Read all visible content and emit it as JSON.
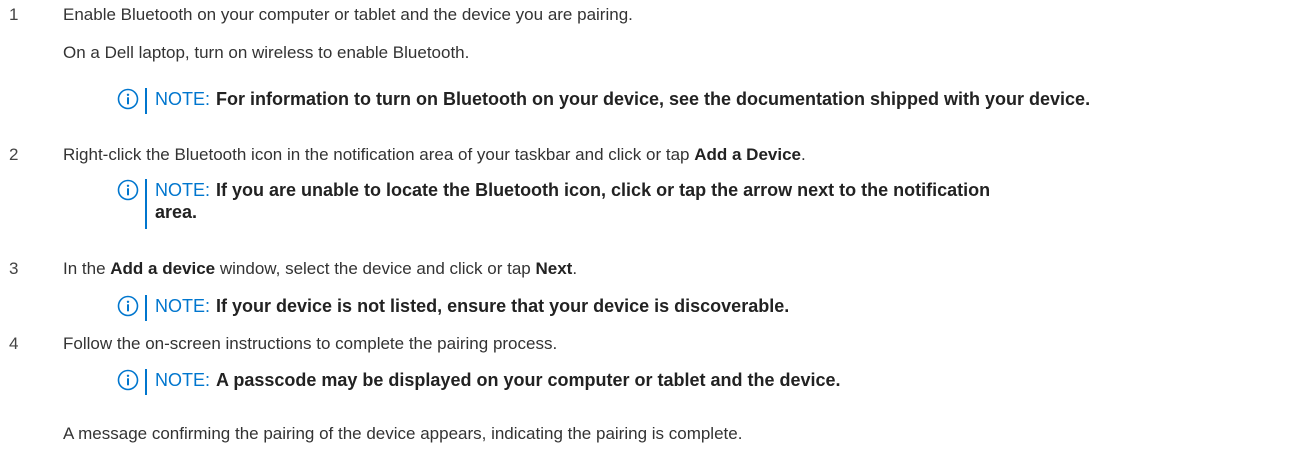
{
  "steps": [
    {
      "number": "1",
      "text": "Enable Bluetooth on your computer or tablet and the device you are pairing.",
      "subtext": "On a Dell laptop, turn on wireless to enable Bluetooth.",
      "note": "For information to turn on Bluetooth on your device, see the documentation shipped with your device."
    },
    {
      "number": "2",
      "text_before": "Right-click the Bluetooth icon in the notification area of your taskbar and click or tap ",
      "text_bold": "Add a Device",
      "text_after": ".",
      "note_line1": "If you are unable to locate the Bluetooth icon, click or tap the arrow next to the notification",
      "note_line2": "area."
    },
    {
      "number": "3",
      "text_part1": "In the ",
      "text_bold1": "Add a device",
      "text_part2": " window, select the device and click or tap ",
      "text_bold2": "Next",
      "text_part3": ".",
      "note": "If your device is not listed, ensure that your device is discoverable."
    },
    {
      "number": "4",
      "text": "Follow the on-screen instructions to complete the pairing process.",
      "note": "A passcode may be displayed on your computer or tablet and the device."
    }
  ],
  "note_label": "NOTE:",
  "closing": "A message confirming the pairing of the device appears, indicating the pairing is complete.",
  "colors": {
    "accent": "#0076ce",
    "text": "#333333"
  },
  "icons": {
    "note": "info-circle-icon"
  }
}
